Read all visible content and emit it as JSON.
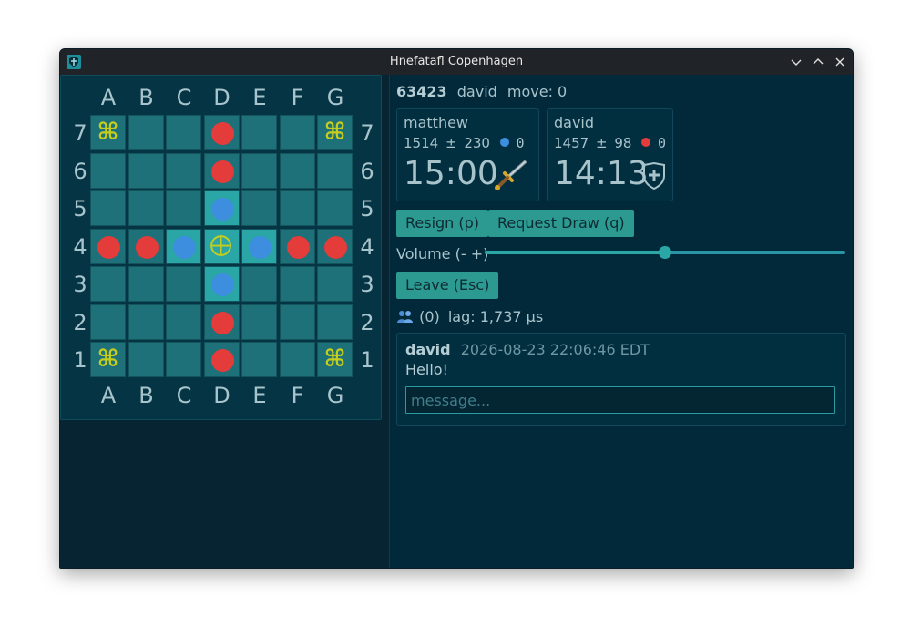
{
  "window": {
    "title": "Hnefatafl Copenhagen"
  },
  "board": {
    "columns": [
      "A",
      "B",
      "C",
      "D",
      "E",
      "F",
      "G"
    ],
    "rows": [
      "7",
      "6",
      "5",
      "4",
      "3",
      "2",
      "1"
    ],
    "highlighted": [
      "D5",
      "C4",
      "D4",
      "E4",
      "D3"
    ],
    "corners": [
      "A7",
      "G7",
      "A1",
      "G1"
    ],
    "corner_glyph": "⌘",
    "attackers": [
      "D7",
      "D6",
      "A4",
      "B4",
      "F4",
      "G4",
      "D2",
      "D1"
    ],
    "defenders": [
      "D5",
      "C4",
      "E4",
      "D3"
    ],
    "king": "D4",
    "colors": {
      "attacker": "#e43b3b",
      "defender": "#3e8ee0",
      "corner": "#c6ce1d",
      "square": "#1e7179",
      "highlight": "#2aa6a6"
    }
  },
  "game": {
    "id": "63423",
    "user": "david",
    "move_label": "move: 0"
  },
  "players": [
    {
      "name": "matthew",
      "rating": "1514",
      "rating_sep": "±",
      "deviation": "230",
      "side_color": "#3e8ee0",
      "captures": "0",
      "time": "15:00",
      "icon": "dagger-icon"
    },
    {
      "name": "david",
      "rating": "1457",
      "rating_sep": "±",
      "deviation": "98",
      "side_color": "#e43b3b",
      "captures": "0",
      "time": "14:13",
      "icon": "shield-icon"
    }
  ],
  "controls": {
    "resign": "Resign (p)",
    "draw": "Request Draw (q)",
    "volume_label": "Volume (- +)",
    "volume": 0.5,
    "leave": "Leave (Esc)"
  },
  "status": {
    "users": "(0)",
    "lag": "lag: 1,737 μs"
  },
  "chat": {
    "messages": [
      {
        "author": "david",
        "time": "2026-08-23 22:06:46 EDT",
        "text": "Hello!"
      }
    ],
    "placeholder": "message..."
  }
}
